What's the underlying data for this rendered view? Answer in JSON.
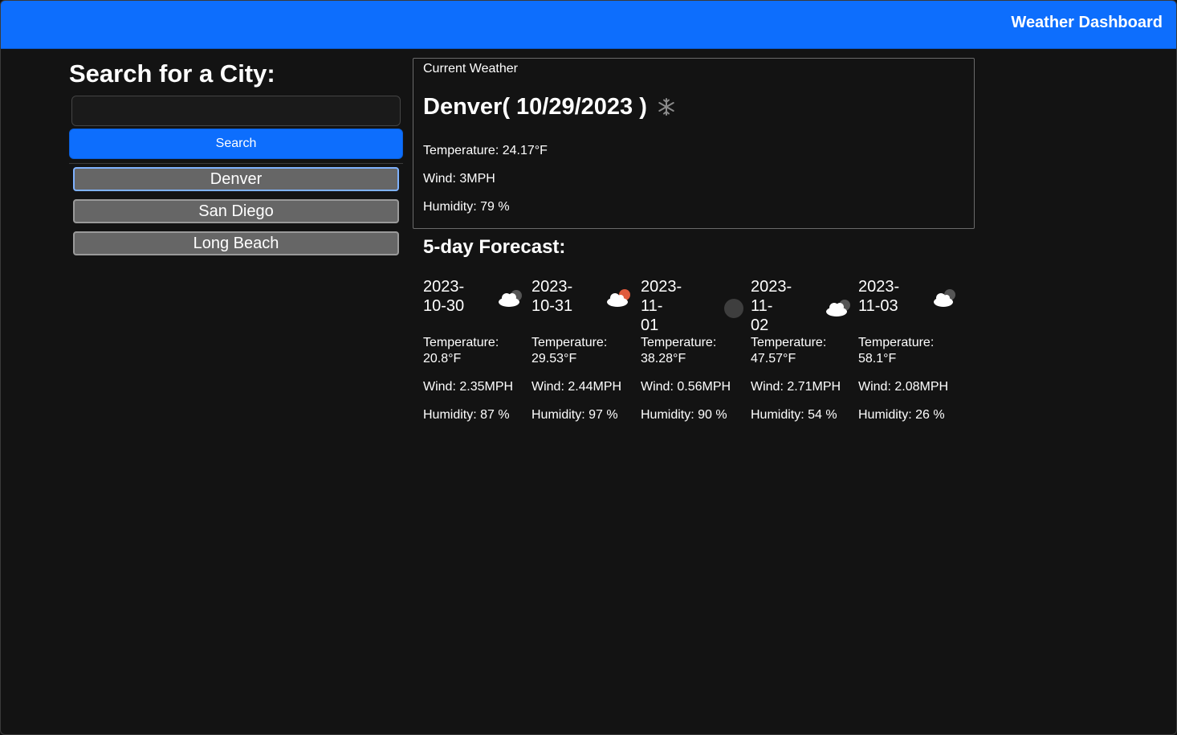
{
  "navbar": {
    "brand": "Weather Dashboard"
  },
  "sidebar": {
    "heading": "Search for a City:",
    "search_value": "",
    "search_button": "Search",
    "history": [
      "Denver",
      "San Diego",
      "Long Beach"
    ]
  },
  "current": {
    "label": "Current Weather",
    "title": "Denver( 10/29/2023 )",
    "icon": "snow-icon",
    "temperature": "Temperature: 24.17°F",
    "wind": "Wind: 3MPH",
    "humidity": "Humidity: 79 %"
  },
  "forecast": {
    "title": "5-day Forecast:",
    "days": [
      {
        "date_line1": "2023-",
        "date_line2": "10-30",
        "icon": "broken-clouds-icon",
        "temp_label": "Temperature:",
        "temp_value": "20.8°F",
        "wind": "Wind: 2.35MPH",
        "humidity": "Humidity: 87 %"
      },
      {
        "date_line1": "2023-",
        "date_line2": "10-31",
        "icon": "few-clouds-icon",
        "temp_label": "Temperature:",
        "temp_value": "29.53°F",
        "wind": "Wind: 2.44MPH",
        "humidity": "Humidity: 97 %"
      },
      {
        "date_line1": "2023-11-",
        "date_line2": "01",
        "icon": "clear-night-icon",
        "temp_label": "Temperature:",
        "temp_value": "38.28°F",
        "wind": "Wind: 0.56MPH",
        "humidity": "Humidity: 90 %"
      },
      {
        "date_line1": "2023-11-",
        "date_line2": "02",
        "icon": "broken-clouds-icon",
        "temp_label": "Temperature:",
        "temp_value": "47.57°F",
        "wind": "Wind: 2.71MPH",
        "humidity": "Humidity: 54 %"
      },
      {
        "date_line1": "2023-",
        "date_line2": "11-03",
        "icon": "scattered-clouds-night-icon",
        "temp_label": "Temperature:",
        "temp_value": "58.1°F",
        "wind": "Wind: 2.08MPH",
        "humidity": "Humidity: 26 %"
      }
    ]
  },
  "colors": {
    "primary": "#0d6efd",
    "background": "#131313",
    "history_button": "#666666"
  }
}
